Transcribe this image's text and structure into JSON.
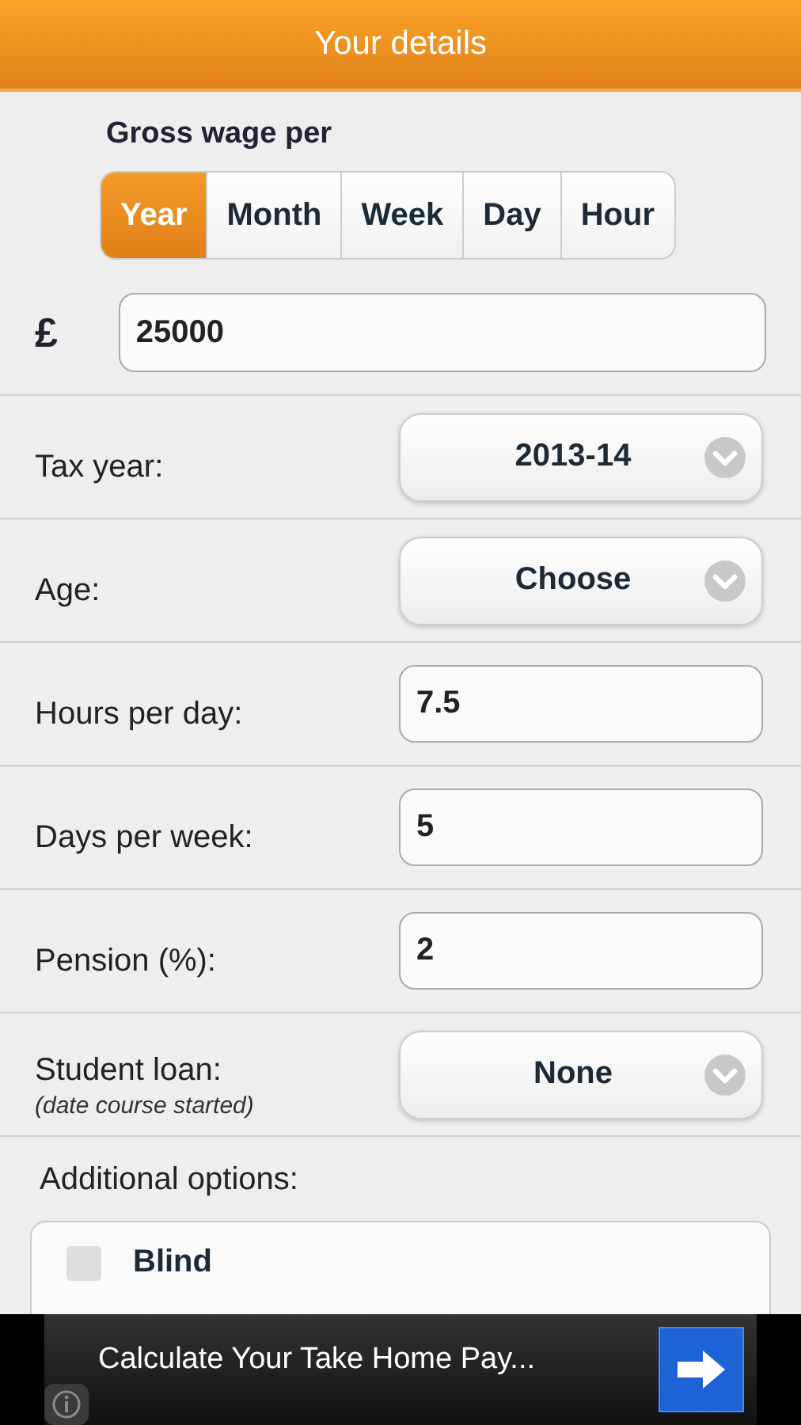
{
  "header": {
    "title": "Your details"
  },
  "wage": {
    "label": "Gross wage per",
    "periods": [
      {
        "label": "Year",
        "selected": true
      },
      {
        "label": "Month",
        "selected": false
      },
      {
        "label": "Week",
        "selected": false
      },
      {
        "label": "Day",
        "selected": false
      },
      {
        "label": "Hour",
        "selected": false
      }
    ],
    "currency": "£",
    "value": "25000"
  },
  "fields": [
    {
      "kind": "select",
      "label": "Tax year:",
      "value": "2013-14"
    },
    {
      "kind": "select",
      "label": "Age:",
      "value": "Choose"
    },
    {
      "kind": "input",
      "label": "Hours per day:",
      "value": "7.5"
    },
    {
      "kind": "input",
      "label": "Days per week:",
      "value": "5"
    },
    {
      "kind": "input",
      "label": "Pension (%):",
      "value": "2"
    },
    {
      "kind": "select",
      "label": "Student loan:",
      "note": "(date course started)",
      "value": "None"
    }
  ],
  "additional": {
    "label": "Additional options:",
    "options": [
      {
        "label": "Blind",
        "checked": false
      }
    ]
  },
  "ad": {
    "text": "Calculate Your Take Home Pay..."
  }
}
